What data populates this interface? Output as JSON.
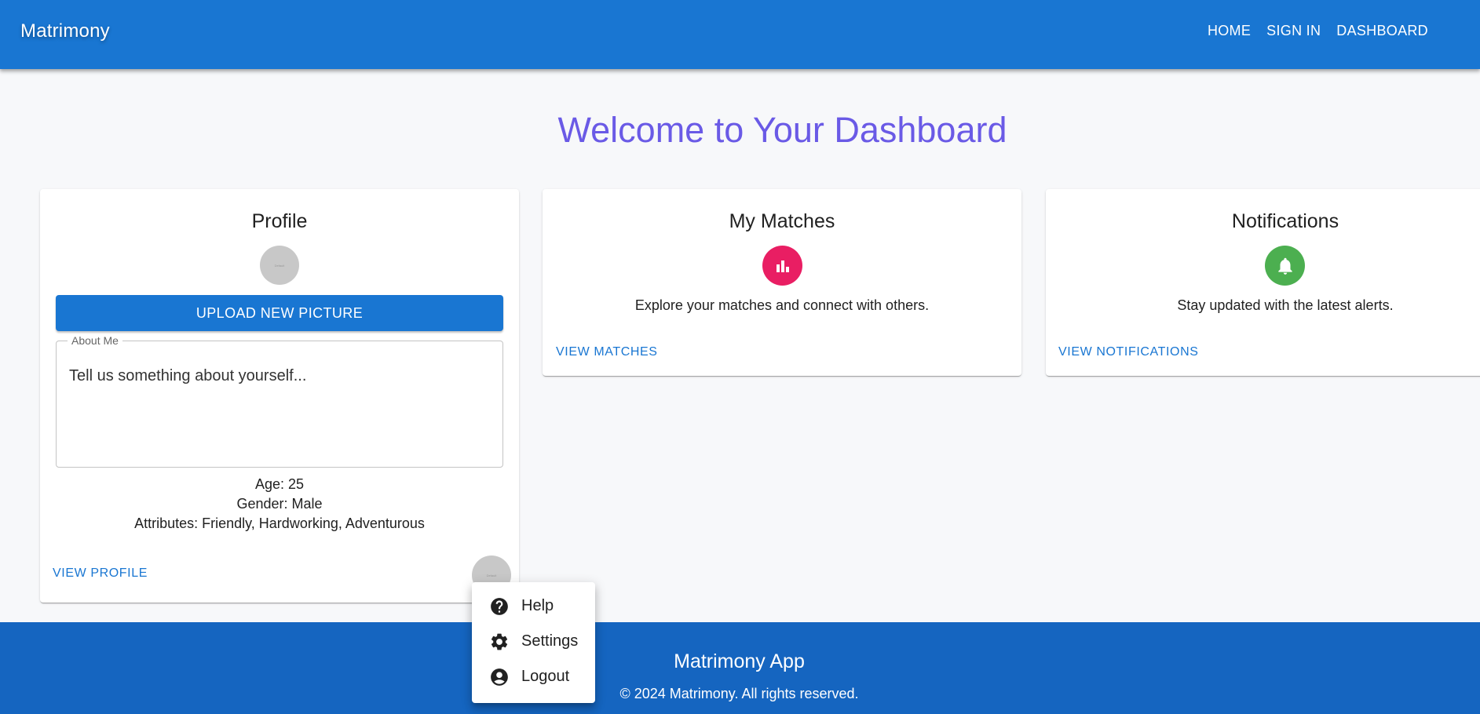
{
  "header": {
    "brand": "Matrimony",
    "nav": [
      "HOME",
      "SIGN IN",
      "DASHBOARD"
    ]
  },
  "page": {
    "title": "Welcome to Your Dashboard"
  },
  "profile_card": {
    "title": "Profile",
    "avatar_text": "Default",
    "upload_label": "UPLOAD NEW PICTURE",
    "about_label": "About Me",
    "about_placeholder": "Tell us something about yourself...",
    "age": "Age: 25",
    "gender": "Gender: Male",
    "attributes": "Attributes: Friendly, Hardworking, Adventurous",
    "view_label": "VIEW PROFILE"
  },
  "matches_card": {
    "title": "My Matches",
    "description": "Explore your matches and connect with others.",
    "link_label": "VIEW MATCHES",
    "icon": "bar-chart-icon",
    "icon_color": "#e91e63"
  },
  "notifications_card": {
    "title": "Notifications",
    "description": "Stay updated with the latest alerts.",
    "link_label": "VIEW NOTIFICATIONS",
    "icon": "bell-icon",
    "icon_color": "#4caf50"
  },
  "user_menu": {
    "items": [
      {
        "label": "Help",
        "icon": "help-icon"
      },
      {
        "label": "Settings",
        "icon": "gear-icon"
      },
      {
        "label": "Logout",
        "icon": "account-circle-icon"
      }
    ]
  },
  "footer": {
    "title": "Matrimony App",
    "copyright": "© 2024 Matrimony. All rights reserved."
  },
  "colors": {
    "primary": "#1976d2",
    "footer": "#1565c0",
    "title": "#6a5ae6"
  }
}
